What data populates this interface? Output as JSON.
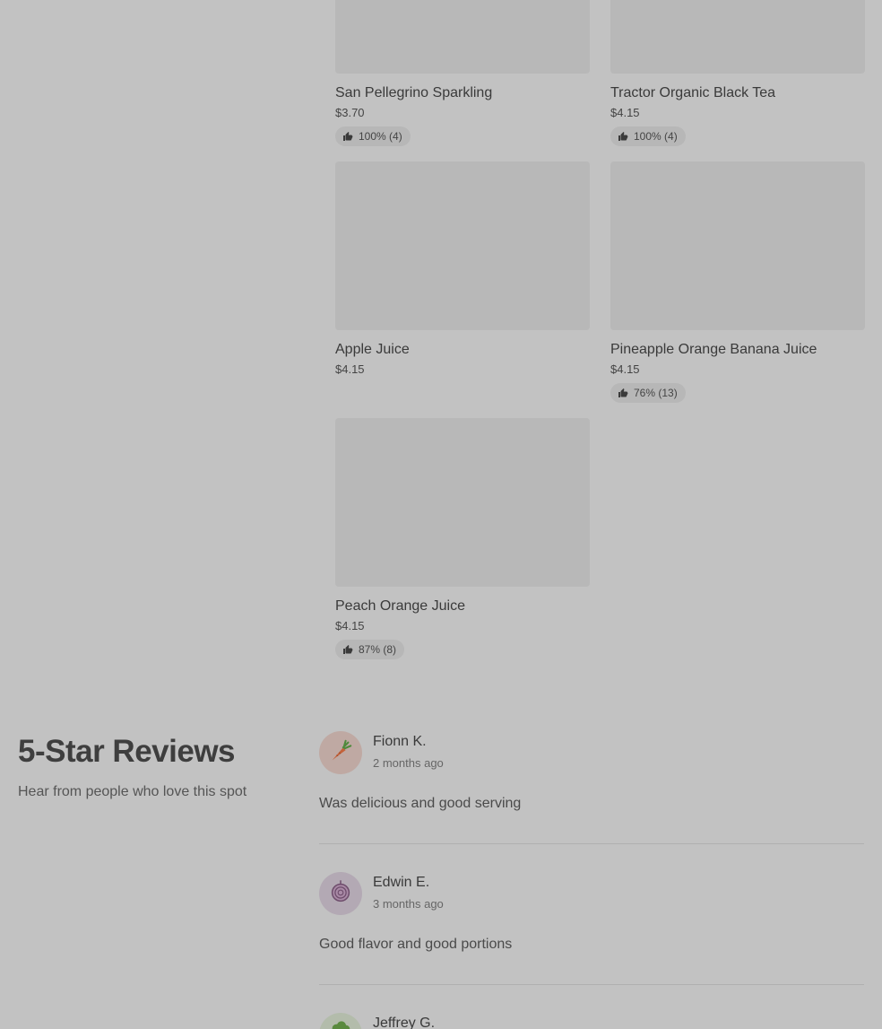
{
  "menu_items": [
    {
      "name": "San Pellegrino Sparkling",
      "price": "$3.70",
      "rating": "100% (4)"
    },
    {
      "name": "Tractor Organic Black Tea",
      "price": "$4.15",
      "rating": "100% (4)"
    },
    {
      "name": "Apple Juice",
      "price": "$4.15",
      "rating": null
    },
    {
      "name": "Pineapple Orange Banana Juice",
      "price": "$4.15",
      "rating": "76% (13)"
    },
    {
      "name": "Peach Orange Juice",
      "price": "$4.15",
      "rating": "87% (8)"
    }
  ],
  "reviews_section": {
    "title": "5-Star Reviews",
    "subtitle": "Hear from people who love this spot"
  },
  "reviews": [
    {
      "name": "Fionn K.",
      "time": "2 months ago",
      "text": "Was delicious and good serving",
      "avatar_icon": "carrot-icon",
      "avatar_bg": "#bfa9a3"
    },
    {
      "name": "Edwin E.",
      "time": "3 months ago",
      "text": "Good flavor and good portions",
      "avatar_icon": "onion-icon",
      "avatar_bg": "#b3a9b4"
    },
    {
      "name": "Jeffrey G.",
      "time": "",
      "text": "",
      "avatar_icon": "broccoli-icon",
      "avatar_bg": "#b3bcab"
    }
  ],
  "colors": {
    "background": "#c2c2c2",
    "placeholder": "#b8b8b8",
    "pill": "#b7b7b7"
  }
}
